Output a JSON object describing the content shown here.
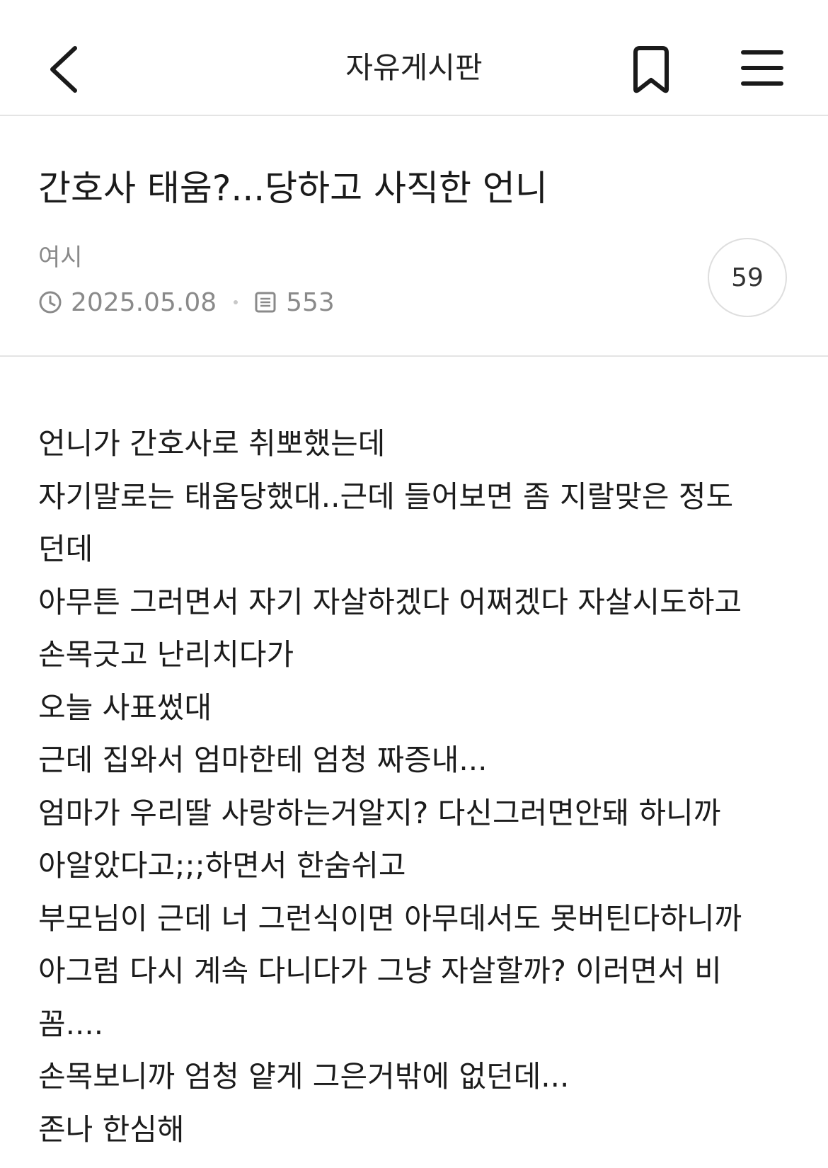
{
  "header": {
    "title": "자유게시판",
    "back_icon": "chevron-left-icon",
    "bookmark_icon": "bookmark-icon",
    "menu_icon": "hamburger-menu-icon"
  },
  "post": {
    "title": "간호사 태움?...당하고 사직한 언니",
    "author": "여시",
    "date": "2025.05.08",
    "views": "553",
    "comment_count": "59",
    "date_icon": "clock-icon",
    "views_icon": "document-icon"
  },
  "body_lines": [
    "언니가 간호사로 취뽀했는데",
    "자기말로는 태움당했대..근데 들어보면 좀 지랄맞은 정도",
    "던데",
    "아무튼 그러면서 자기 자살하겠다 어쩌겠다 자살시도하고",
    "손목긋고 난리치다가",
    "오늘 사표썼대",
    "근데 집와서 엄마한테 엄청 짜증내...",
    "엄마가 우리딸 사랑하는거알지? 다신그러면안돼 하니까",
    "아알았다고;;;하면서 한숨쉬고",
    "부모님이 근데 너 그런식이면 아무데서도 못버틴다하니까",
    "아그럼 다시 계속 다니다가 그냥 자살할까? 이러면서 비",
    "꼼....",
    "손목보니까 엄청 얕게 그은거밖에 없던데...",
    "존나 한심해"
  ],
  "colors": {
    "text": "#1c1c1c",
    "meta": "#8a8a8a",
    "divider": "#e4e4e4"
  }
}
